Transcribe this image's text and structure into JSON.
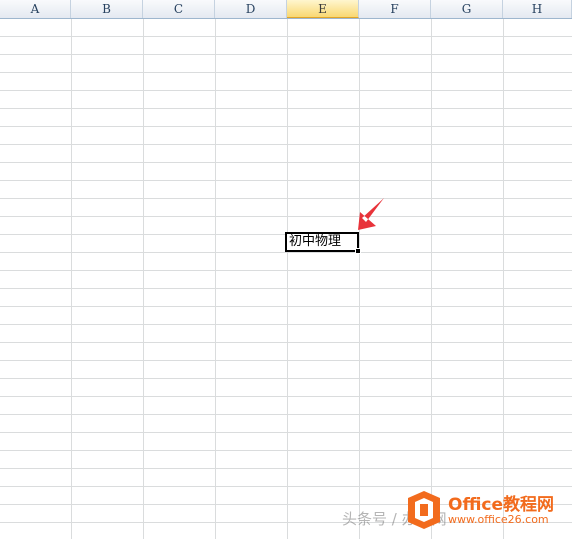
{
  "columns": [
    {
      "label": "A",
      "active": false
    },
    {
      "label": "B",
      "active": false
    },
    {
      "label": "C",
      "active": false
    },
    {
      "label": "D",
      "active": false
    },
    {
      "label": "E",
      "active": true
    },
    {
      "label": "F",
      "active": false
    },
    {
      "label": "G",
      "active": false
    },
    {
      "label": "H",
      "active": false
    }
  ],
  "active_cell": {
    "column": "E",
    "value": "初中物理"
  },
  "colors": {
    "arrow": "#e8333a",
    "active_header": "#f9d872",
    "watermark_orange": "#f26b1d"
  },
  "watermark": {
    "title": "Office教程网",
    "url": "www.office26.com",
    "prefix": "头条号 / 办公网"
  }
}
